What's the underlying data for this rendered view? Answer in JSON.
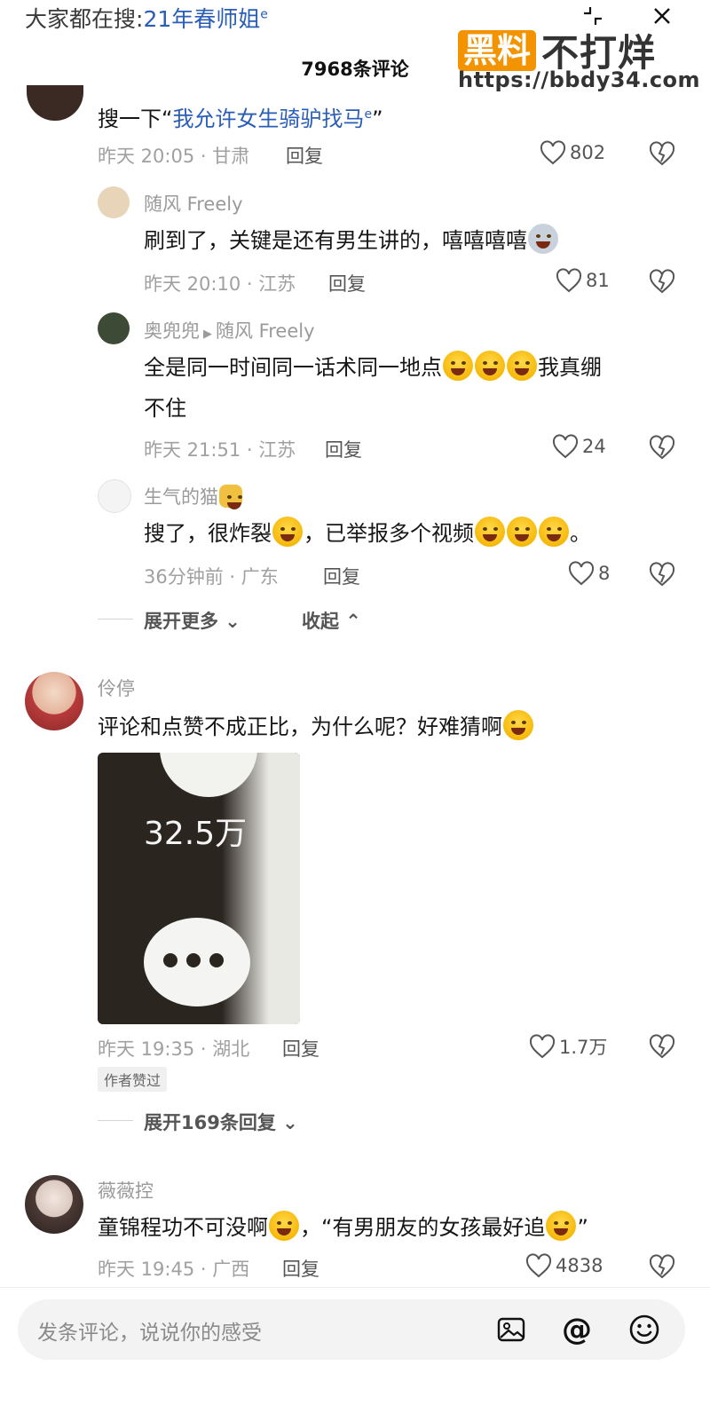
{
  "header": {
    "search_prefix": "大家都在搜:",
    "search_keyword": "21年春师姐",
    "title": "7968条评论"
  },
  "watermark": {
    "badge": "黑料",
    "text": "不打烊",
    "url": "https://bbdy34.com"
  },
  "comments": [
    {
      "text_pre": "搜一下“",
      "text_link": "我允许女生骑驴找马",
      "text_post": "”",
      "time_loc": "昨天 20:05 · 甘肃",
      "reply": "回复",
      "likes": "802"
    },
    {
      "name": "随风 Freely",
      "text": "刷到了，关键是还有男生讲的，嘻嘻嘻嘻",
      "time_loc": "昨天 20:10 · 江苏",
      "reply": "回复",
      "likes": "81"
    },
    {
      "name": "奥兜兜",
      "reply_to": "随风 Freely",
      "text_line1": "全是同一时间同一话术同一地点",
      "text_line1_tail": "我真绷",
      "text_line2": "不住",
      "time_loc": "昨天 21:51 · 江苏",
      "reply": "回复",
      "likes": "24"
    },
    {
      "name": "生气的猫",
      "text_a": "搜了，很炸裂",
      "text_b": "，已举报多个视频",
      "text_c": "。",
      "time_loc": "36分钟前 · 广东",
      "reply": "回复",
      "likes": "8"
    },
    {
      "name": "伶停",
      "text": "评论和点赞不成正比，为什么呢？好难猜啊",
      "image_number": "32.5万",
      "time_loc": "昨天 19:35 · 湖北",
      "reply": "回复",
      "likes": "1.7万",
      "badge": "作者赞过"
    },
    {
      "name": "薇薇控",
      "text_a": "童锦程功不可没啊",
      "text_b": "，“有男朋友的女孩最好追",
      "text_c": "”",
      "time_loc": "昨天 19:45 · 广西",
      "reply": "回复",
      "likes": "4838"
    }
  ],
  "thread_controls": {
    "expand_more": "展开更多",
    "collapse": "收起"
  },
  "expand_replies": "展开169条回复",
  "bottom": {
    "placeholder": "发条评论，说说你的感受"
  },
  "icons": [
    "minimize-icon",
    "close-icon",
    "heart-icon",
    "dislike-icon",
    "image-icon",
    "at-icon",
    "emoji-icon"
  ]
}
